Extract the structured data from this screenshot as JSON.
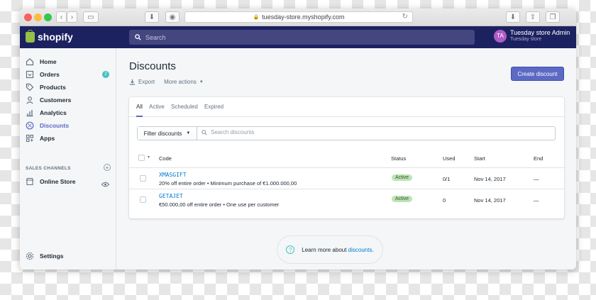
{
  "browser": {
    "url": "tuesday-store.myshopify.com"
  },
  "topbar": {
    "logo_text": "shopify",
    "search_placeholder": "Search",
    "user_initials": "TA",
    "user_name": "Tuesday store Admin",
    "store_name": "Tuesday store"
  },
  "sidebar": {
    "items": [
      {
        "label": "Home"
      },
      {
        "label": "Orders",
        "badge": "2"
      },
      {
        "label": "Products"
      },
      {
        "label": "Customers"
      },
      {
        "label": "Analytics"
      },
      {
        "label": "Discounts"
      },
      {
        "label": "Apps"
      }
    ],
    "sales_channels_title": "SALES CHANNELS",
    "online_store": "Online Store",
    "settings": "Settings"
  },
  "page": {
    "title": "Discounts",
    "export_label": "Export",
    "more_actions_label": "More actions",
    "create_button": "Create discount"
  },
  "tabs": [
    "All",
    "Active",
    "Scheduled",
    "Expired"
  ],
  "filter": {
    "button_label": "Filter discounts",
    "search_placeholder": "Search discounts"
  },
  "table": {
    "headers": {
      "code": "Code",
      "status": "Status",
      "used": "Used",
      "start": "Start",
      "end": "End"
    },
    "rows": [
      {
        "code": "XMASGIFT",
        "description": "20% off entire order • Minimum purchase of €1.000.000,00",
        "status": "Active",
        "used": "0/1",
        "start": "Nov 14, 2017",
        "end": "—"
      },
      {
        "code": "GETAJET",
        "description": "€50.000,00 off entire order • One use per customer",
        "status": "Active",
        "used": "0",
        "start": "Nov 14, 2017",
        "end": "—"
      }
    ]
  },
  "learn_more": {
    "prefix": "Learn more about",
    "link": "discounts",
    "suffix": "."
  },
  "colors": {
    "topbar": "#1c2260",
    "primary": "#5c6ac4",
    "status_bg": "#bbe5b3",
    "link": "#007ace"
  }
}
